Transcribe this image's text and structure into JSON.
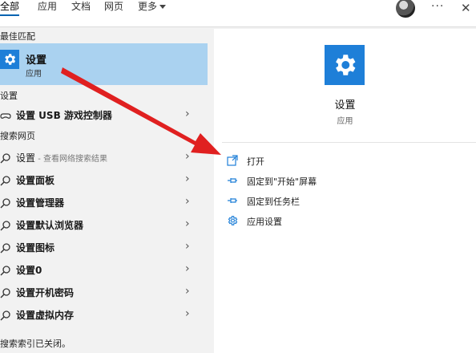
{
  "tabs": [
    {
      "label": "全部",
      "active": true
    },
    {
      "label": "应用"
    },
    {
      "label": "文档"
    },
    {
      "label": "网页"
    },
    {
      "label": "更多"
    }
  ],
  "toolbar": {
    "more_icon": "ellipsis-icon",
    "close_icon": "close-icon",
    "dots": "···",
    "close": "✕"
  },
  "left": {
    "best_match_header": "最佳匹配",
    "best_match": {
      "title": "设置",
      "subtitle": "应用",
      "icon": "gear-icon"
    },
    "settings_header": "设置",
    "settings_items": [
      {
        "label": "设置 USB 游戏控制器",
        "icon": "gamepad-icon"
      }
    ],
    "web_header": "搜索网页",
    "web_items": [
      {
        "label": "设置",
        "hint": " - 查看网络搜索结果"
      },
      {
        "label": "设置面板"
      },
      {
        "label": "设置管理器"
      },
      {
        "label": "设置默认浏览器"
      },
      {
        "label": "设置图标"
      },
      {
        "label": "设置0"
      },
      {
        "label": "设置开机密码"
      },
      {
        "label": "设置虚拟内存"
      }
    ],
    "footer": "搜索索引已关闭。",
    "footer_link": "▂▂▂▂▂▂▂▂."
  },
  "detail": {
    "title": "设置",
    "subtitle": "应用",
    "actions": [
      {
        "label": "打开",
        "icon": "open-icon"
      },
      {
        "label": "固定到\"开始\"屏幕",
        "icon": "pin-icon"
      },
      {
        "label": "固定到任务栏",
        "icon": "pin-icon"
      },
      {
        "label": "应用设置",
        "icon": "gear-icon"
      }
    ]
  },
  "colors": {
    "accent": "#1e7fd8",
    "selection": "#aad2f0",
    "annotation_arrow": "#e02020"
  }
}
